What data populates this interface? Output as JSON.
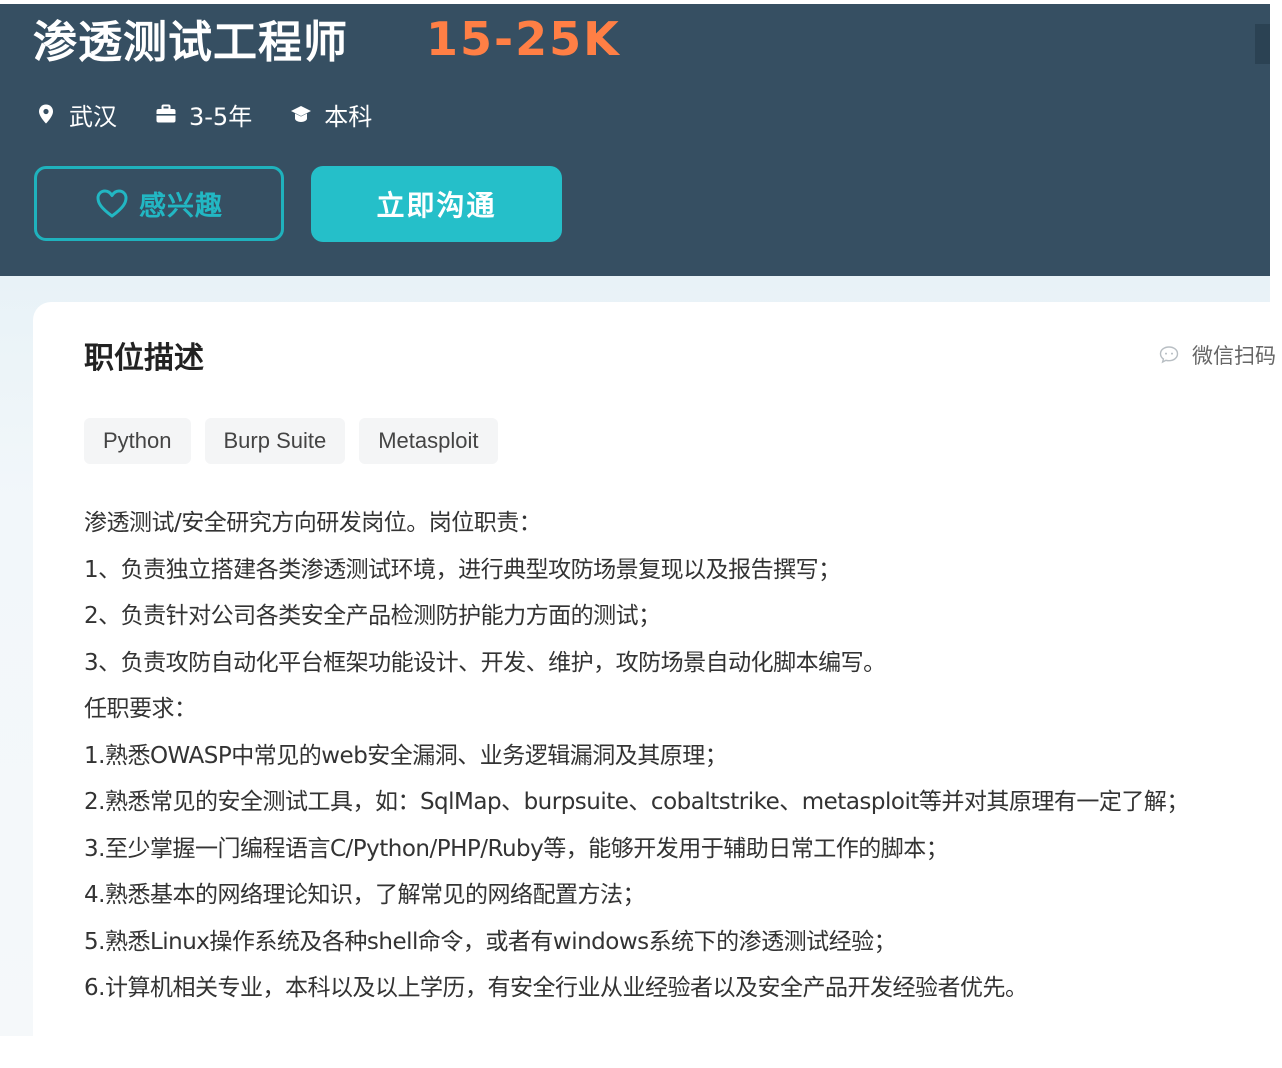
{
  "header": {
    "job_title": "渗透测试工程师",
    "salary": "15-25K",
    "location": "武汉",
    "experience": "3-5年",
    "education": "本科",
    "interest_label": "感兴趣",
    "chat_label": "立即沟通"
  },
  "icons": {
    "location": "location-pin-icon",
    "experience": "briefcase-icon",
    "education": "graduation-cap-icon",
    "interest": "heart-icon",
    "share": "wechat-icon"
  },
  "colors": {
    "banner": "#364f62",
    "salary": "#ff7f45",
    "accent": "#25bfc9"
  },
  "section": {
    "title": "职位描述",
    "share_text": "微信扫码"
  },
  "tags": [
    "Python",
    "Burp Suite",
    "Metasploit"
  ],
  "description": [
    "渗透测试/安全研究方向研发岗位。岗位职责：",
    "1、负责独立搭建各类渗透测试环境，进行典型攻防场景复现以及报告撰写；",
    "2、负责针对公司各类安全产品检测防护能力方面的测试；",
    "3、负责攻防自动化平台框架功能设计、开发、维护，攻防场景自动化脚本编写。",
    "任职要求：",
    "1.熟悉OWASP中常见的web安全漏洞、业务逻辑漏洞及其原理；",
    "2.熟悉常见的安全测试工具，如：SqlMap、burpsuite、cobaltstrike、metasploit等并对其原理有一定了解；",
    "3.至少掌握一门编程语言C/Python/PHP/Ruby等，能够开发用于辅助日常工作的脚本；",
    "4.熟悉基本的网络理论知识，了解常见的网络配置方法；",
    "5.熟悉Linux操作系统及各种shell命令，或者有windows系统下的渗透测试经验；",
    "6.计算机相关专业，本科以及以上学历，有安全行业从业经验者以及安全产品开发经验者优先。"
  ]
}
